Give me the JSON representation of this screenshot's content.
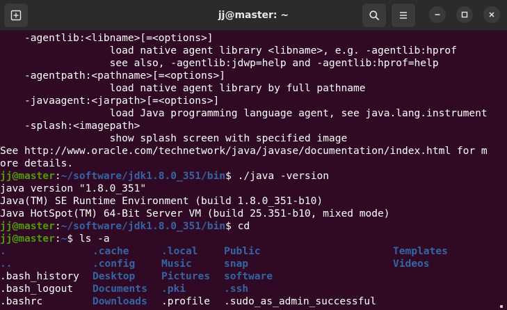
{
  "window": {
    "title": "jj@master: ~",
    "icons": {
      "new_tab": "new-tab-icon",
      "search": "search-icon",
      "menu": "hamburger-menu-icon",
      "minimize": "minimize-icon",
      "maximize": "maximize-icon",
      "close": "close-icon"
    }
  },
  "colors": {
    "background": "#300a24",
    "titlebar": "#2b2b2b",
    "text": "#ffffff",
    "prompt_user": "#4e9a06",
    "prompt_path": "#3465a4",
    "directory": "#3465a4"
  },
  "terminal": {
    "help_lines": [
      "    -agentlib:<libname>[=<options>]",
      "                  load native agent library <libname>, e.g. -agentlib:hprof",
      "                  see also, -agentlib:jdwp=help and -agentlib:hprof=help",
      "    -agentpath:<pathname>[=<options>]",
      "                  load native agent library by full pathname",
      "    -javaagent:<jarpath>[=<options>]",
      "                  load Java programming language agent, see java.lang.instrument",
      "    -splash:<imagepath>",
      "                  show splash screen with specified image",
      "See http://www.oracle.com/technetwork/java/javase/documentation/index.html for m",
      "ore details."
    ],
    "prompt1": {
      "user": "jj@master",
      "sep": ":",
      "path": "~/software/jdk1.8.0_351/bin",
      "sign": "$ ",
      "command": "./java -version"
    },
    "version_lines": [
      "java version \"1.8.0_351\"",
      "Java(TM) SE Runtime Environment (build 1.8.0_351-b10)",
      "Java HotSpot(TM) 64-Bit Server VM (build 25.351-b10, mixed mode)"
    ],
    "prompt2": {
      "user": "jj@master",
      "sep": ":",
      "path": "~/software/jdk1.8.0_351/bin",
      "sign": "$ ",
      "command": "cd"
    },
    "prompt3": {
      "user": "jj@master",
      "sep": ":",
      "path": "~",
      "sign": "$ ",
      "command": "ls -a"
    },
    "ls_rows": [
      [
        {
          "name": ".",
          "dir": true
        },
        {
          "name": ".cache",
          "dir": true
        },
        {
          "name": ".local",
          "dir": true
        },
        {
          "name": "Public",
          "dir": true
        },
        {
          "name": "Templates",
          "dir": true
        }
      ],
      [
        {
          "name": "..",
          "dir": true
        },
        {
          "name": ".config",
          "dir": true
        },
        {
          "name": "Music",
          "dir": true
        },
        {
          "name": "snap",
          "dir": true
        },
        {
          "name": "Videos",
          "dir": true
        }
      ],
      [
        {
          "name": ".bash_history",
          "dir": false
        },
        {
          "name": "Desktop",
          "dir": true
        },
        {
          "name": "Pictures",
          "dir": true
        },
        {
          "name": "software",
          "dir": true
        },
        {
          "name": "",
          "dir": false
        }
      ],
      [
        {
          "name": ".bash_logout",
          "dir": false
        },
        {
          "name": "Documents",
          "dir": true
        },
        {
          "name": ".pki",
          "dir": true
        },
        {
          "name": ".ssh",
          "dir": true
        },
        {
          "name": "",
          "dir": false
        }
      ],
      [
        {
          "name": ".bashrc",
          "dir": false
        },
        {
          "name": "Downloads",
          "dir": true
        },
        {
          "name": ".profile",
          "dir": false
        },
        {
          "name": ".sudo_as_admin_successful",
          "dir": false
        },
        {
          "name": "",
          "dir": false
        }
      ]
    ]
  }
}
